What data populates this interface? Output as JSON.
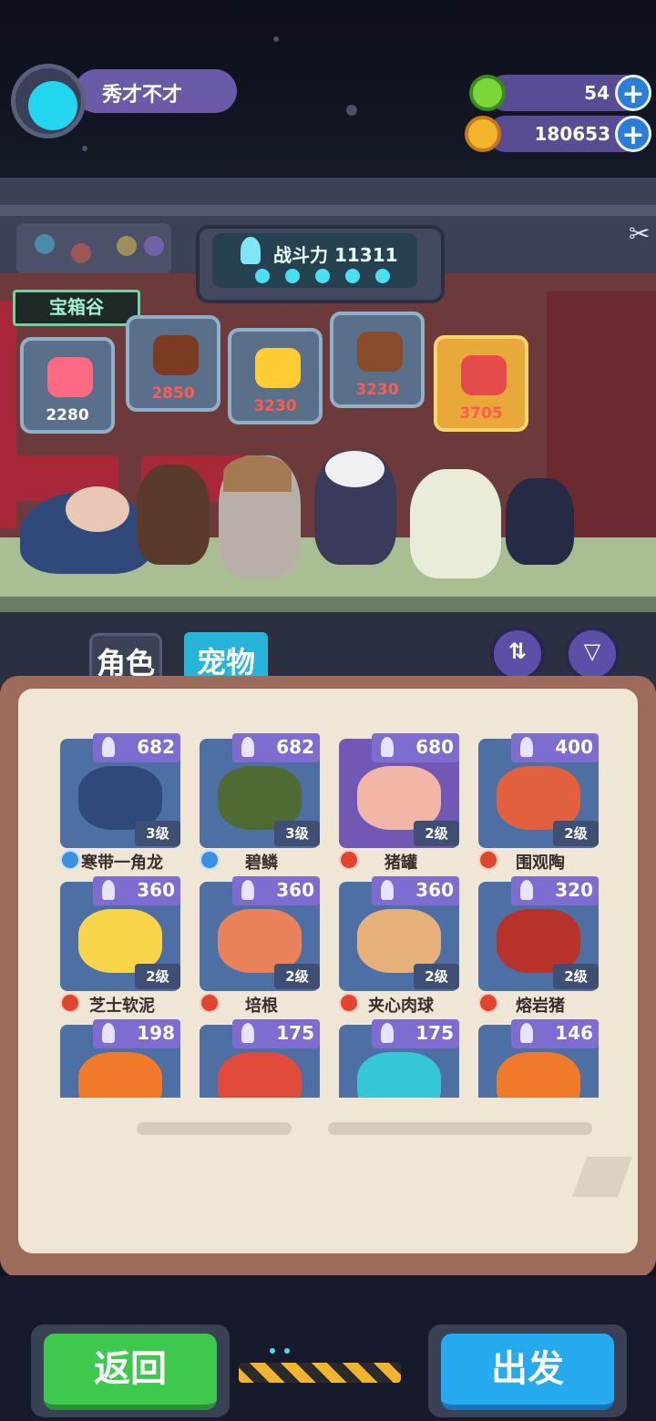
{
  "player": {
    "name": "秀才不才"
  },
  "currency": [
    {
      "icon": "green-gem-icon",
      "value": "54"
    },
    {
      "icon": "gold-planet-coin-icon",
      "value": "180653"
    }
  ],
  "combat": {
    "label": "战斗力 11311"
  },
  "area": {
    "name": "宝箱谷"
  },
  "chests": [
    {
      "value": "2280",
      "color": "#ff6a83"
    },
    {
      "value": "2850",
      "color": "#7b3b22"
    },
    {
      "value": "3230",
      "color": "#ffcc33"
    },
    {
      "value": "3230",
      "color": "#8a4b2a"
    },
    {
      "value": "3705",
      "color": "#e64b4b"
    }
  ],
  "tabs": {
    "characters": "角色",
    "pets": "宠物"
  },
  "pets": [
    {
      "power": "682",
      "level": "3级",
      "name": "寒带一角龙",
      "element": "water",
      "color": "#2f4a7a",
      "bg": "blue"
    },
    {
      "power": "682",
      "level": "3级",
      "name": "碧鳞",
      "element": "water",
      "color": "#4f6b33",
      "bg": "blue"
    },
    {
      "power": "680",
      "level": "2级",
      "name": "猪罐",
      "element": "fire",
      "color": "#f2b6a6",
      "bg": "purple"
    },
    {
      "power": "400",
      "level": "2级",
      "name": "围观陶",
      "element": "fire",
      "color": "#e2603d",
      "bg": "blue"
    },
    {
      "power": "360",
      "level": "2级",
      "name": "芝士软泥",
      "element": "fire",
      "color": "#f7d44a",
      "bg": "blue"
    },
    {
      "power": "360",
      "level": "2级",
      "name": "培根",
      "element": "fire",
      "color": "#e9825a",
      "bg": "blue"
    },
    {
      "power": "360",
      "level": "2级",
      "name": "夹心肉球",
      "element": "fire",
      "color": "#e6b07a",
      "bg": "blue"
    },
    {
      "power": "320",
      "level": "2级",
      "name": "熔岩猪",
      "element": "fire",
      "color": "#b8322a",
      "bg": "blue"
    },
    {
      "power": "198",
      "level": "",
      "name": "",
      "element": "",
      "color": "#f07a2a",
      "bg": "blue"
    },
    {
      "power": "175",
      "level": "",
      "name": "",
      "element": "",
      "color": "#e24a3a",
      "bg": "blue"
    },
    {
      "power": "175",
      "level": "",
      "name": "",
      "element": "",
      "color": "#35c6d8",
      "bg": "blue"
    },
    {
      "power": "146",
      "level": "",
      "name": "",
      "element": "",
      "color": "#f07a2a",
      "bg": "blue"
    }
  ],
  "buttons": {
    "back": "返回",
    "depart": "出发"
  },
  "colors": {
    "accent": "#49e0f2",
    "back": "#3ec84d",
    "depart": "#25a9ef"
  }
}
